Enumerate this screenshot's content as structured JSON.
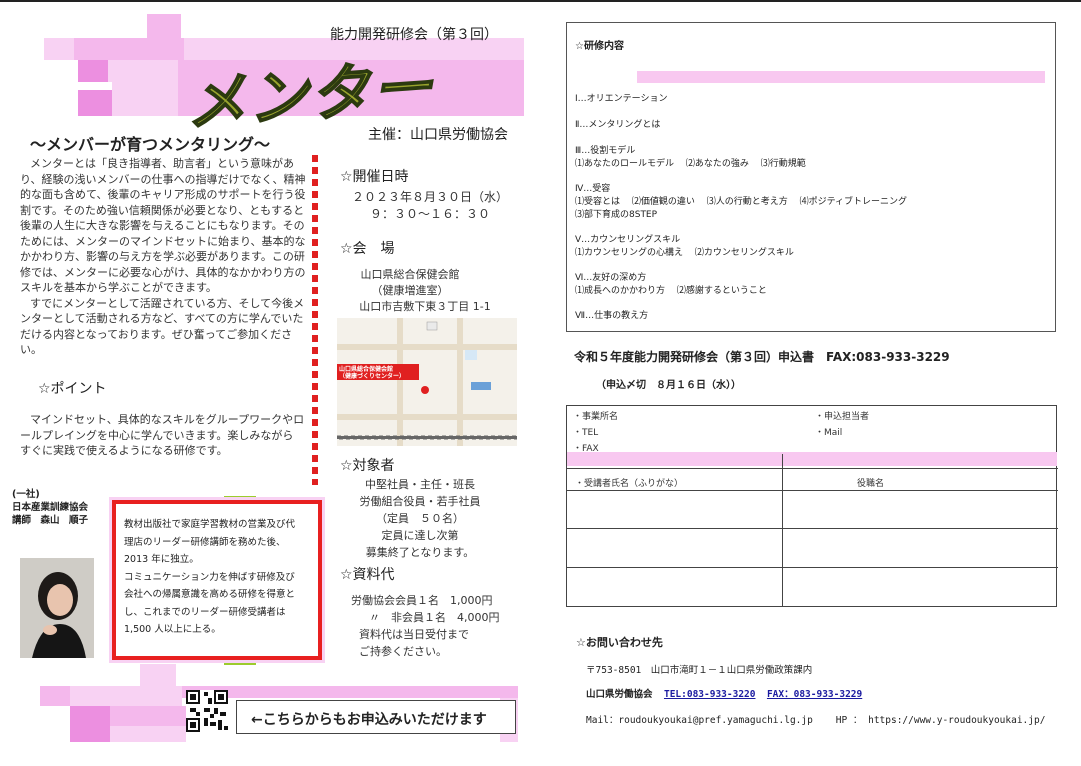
{
  "header": {
    "event_series": "能力開発研修会（第３回）",
    "main_title": "メンター",
    "tagline": "～メンバーが育つメンタリング～",
    "organizer": "主催：山口県労働協会"
  },
  "intro": {
    "lines": [
      "メンターとは「良き指導者、助言者」という意味があ",
      "り、経験の浅いメンバーの仕事への指導だけでなく、精神",
      "的な面も含めて、後輩のキャリア形成のサポートを行う役",
      "割です。そのため強い信頼関係が必要となり、ともすると",
      "後輩の人生に大きな影響を与えることにもなります。その",
      "ためには、メンターのマインドセットに始まり、基本的な",
      "かかわり方、影響の与え方を学ぶ必要があります。この研",
      "修では、メンターに必要な心がけ、具体的なかかわり方の",
      "スキルを基本から学ぶことができます。",
      "すでにメンターとして活躍されている方、そして今後メ",
      "ンターとして活動される方など、すべての方に学んでいた",
      "だける内容となっております。ぜひ奮ってご参加くださ",
      "い。"
    ]
  },
  "point": {
    "heading": "☆ポイント",
    "lines": [
      "マインドセット、具体的なスキルをグループワークやロ",
      "ールプレイングを中心に学んでいきます。楽しみながら",
      "すぐに実践で使えるようになる研修です。"
    ]
  },
  "instructor": {
    "org1": "(一社)",
    "org2": "日本産業訓練協会",
    "name": "講師　森山　順子",
    "bio": [
      "教材出版社で家庭学習教材の営業及び代",
      "理店のリーダー研修講師を務めた後、",
      "2013 年に独立。",
      "コミュニケーション力を伸ばす研修及び",
      "会社への帰属意識を高める研修を得意と",
      "し、これまでのリーダー研修受講者は",
      "1,500 人以上に上る。"
    ]
  },
  "schedule": {
    "heading": "☆開催日時",
    "date": "２０２３年８月３０日（水）",
    "time": "９：３０～１６：３０"
  },
  "venue": {
    "heading": "☆会　場",
    "name": "山口県総合保健会館",
    "sub": "（健康増進室）",
    "address": "山口市吉敷下東３丁目 1-1",
    "map_label1": "山口県総合保健会館",
    "map_label2": "（健康づくりセンター）"
  },
  "target": {
    "heading": "☆対象者",
    "lines": [
      "中堅社員・主任・班長",
      "労働組合役員・若手社員",
      "（定員　５０名）",
      "定員に達し次第",
      "募集終了となります。"
    ]
  },
  "fee": {
    "heading": "☆資料代",
    "lines": [
      "労働協会会員１名　1,000円",
      "〃　非会員１名　4,000円",
      "資料代は当日受付まで",
      "ご持参ください。"
    ]
  },
  "cta": {
    "text": "←こちらからもお申込みいただけます"
  },
  "curriculum": {
    "title": "☆研修内容",
    "items": [
      [
        "Ⅰ…オリエンテーション"
      ],
      [
        "Ⅱ…メンタリングとは"
      ],
      [
        "Ⅲ…役割モデル",
        "⑴あなたのロールモデル　 ⑵あなたの強み　 ⑶行動規範"
      ],
      [
        "Ⅳ…受容",
        "⑴受容とは　 ⑵価値観の違い　 ⑶人の行動と考え方　 ⑷ポジティブトレーニング",
        "⑶部下育成の8STEP"
      ],
      [
        "Ⅴ…カウンセリングスキル",
        "⑴カウンセリングの心構え　 ⑵カウンセリングスキル"
      ],
      [
        "Ⅵ…友好の深め方",
        "⑴成長へのかかわり方　 ⑵感謝するということ"
      ],
      [
        "Ⅶ…仕事の教え方"
      ]
    ]
  },
  "form": {
    "title": "令和５年度能力開発研修会（第３回）申込書　FAX:083-933-3229",
    "deadline": "（申込〆切　８月１６日（水））",
    "company": "・事業所名",
    "tel": "・TEL",
    "fax": "・FAX",
    "contact_person": "・申込担当者",
    "mail": "・Mail",
    "trainee": "・受講者氏名（ふりがな）",
    "position": "役職名"
  },
  "contact": {
    "title": "☆お問い合わせ先",
    "address": "〒753-8501　山口市滝町１－１山口県労働政策課内",
    "org": "山口県労働協会",
    "tel": "TEL:083-933-3220",
    "fax": "FAX：083-933-3229",
    "mail": "Mail：roudoukyoukai@pref.yamaguchi.lg.jp",
    "hp": "HP ： https://www.y-roudoukyoukai.jp/"
  }
}
